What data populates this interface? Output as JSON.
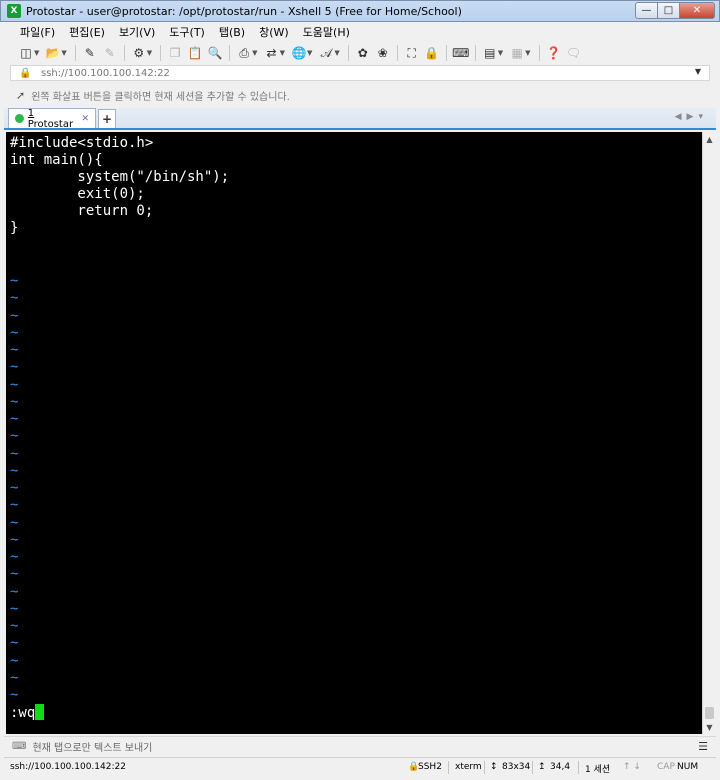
{
  "window": {
    "app_icon": "xshell-icon",
    "title": "Protostar - user@protostar: /opt/protostar/run - Xshell 5 (Free for Home/School)"
  },
  "menubar": {
    "items": [
      "파일(F)",
      "편집(E)",
      "보기(V)",
      "도구(T)",
      "탭(B)",
      "창(W)",
      "도움말(H)"
    ]
  },
  "toolbar": {
    "icons": [
      "new-session-icon",
      "open-icon",
      "reconnect-icon",
      "disconnect-icon",
      "properties-icon",
      "copy-icon",
      "paste-icon",
      "find-icon",
      "print-icon",
      "transfer-icon",
      "globe-icon",
      "font-icon",
      "xftp-icon",
      "xmanager-icon",
      "fullscreen-icon",
      "lock-icon",
      "keyboard-icon",
      "compose-icon",
      "layout-icon",
      "help-icon",
      "chat-icon"
    ]
  },
  "addressbar": {
    "value": "ssh://100.100.100.142:22"
  },
  "hintbar": {
    "text": "왼쪽 화살표 버튼을 클릭하면 현재 세션을 추가할 수 있습니다."
  },
  "tabs": {
    "items": [
      {
        "number": "1",
        "label": "Protostar",
        "status_color": "#2ab84a"
      }
    ],
    "new_tab": "+"
  },
  "terminal": {
    "background": "#000000",
    "cursor_color": "#16d916",
    "tilde_color": "#3b8ee8",
    "lines": [
      "#include<stdio.h>",
      "int main(){",
      "        system(\"/bin/sh\");",
      "        exit(0);",
      "        return 0;",
      "}",
      ""
    ],
    "tilde": "~",
    "tilde_count": 25,
    "command_line": ":wq"
  },
  "sendbar": {
    "text": "현재 탭으로만 텍스트 보내기"
  },
  "statusbar": {
    "address": "ssh://100.100.100.142:22",
    "protocol": "SSH2",
    "terminal_type": "xterm",
    "size": "83x34",
    "cursor_pos": "34,4",
    "sessions": "1 세션",
    "caps": "CAP",
    "num": "NUM"
  }
}
